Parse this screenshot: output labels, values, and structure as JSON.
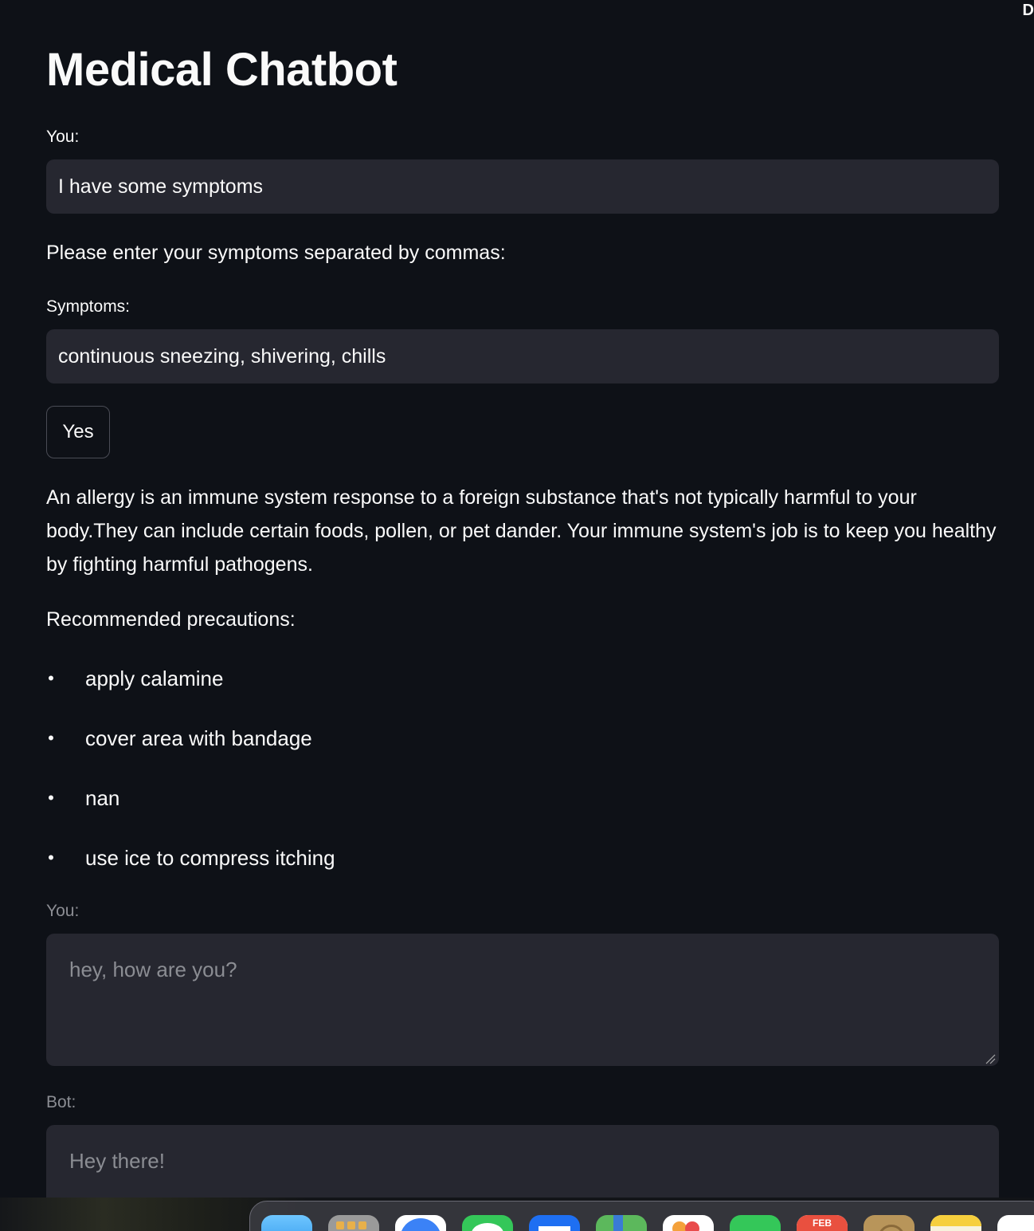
{
  "app": {
    "title": "Medical Chatbot",
    "corner_glyph": "D"
  },
  "first_input": {
    "label": "You:",
    "value": "I have some symptoms"
  },
  "prompt_text": "Please enter your symptoms separated by commas:",
  "symptoms_input": {
    "label": "Symptoms:",
    "value": "continuous sneezing, shivering, chills"
  },
  "yes_button_label": "Yes",
  "description": "An allergy is an immune system response to a foreign substance that's not typically harmful to your body.They can include certain foods, pollen, or pet dander. Your immune system's job is to keep you healthy by fighting harmful pathogens.",
  "precautions": {
    "heading": "Recommended precautions:",
    "bullet": "•",
    "items": [
      "apply calamine",
      "cover area with bandage",
      "nan",
      "use ice to compress itching"
    ]
  },
  "chat_input": {
    "label": "You:",
    "placeholder": "hey, how are you?"
  },
  "bot_output": {
    "label": "Bot:",
    "placeholder": "Hey there!"
  },
  "dock": {
    "calendar_month": "FEB",
    "icons": [
      "finder-icon",
      "launchpad-icon",
      "safari-icon",
      "messages-icon",
      "mail-icon",
      "maps-icon",
      "photos-icon",
      "facetime-icon",
      "calendar-icon",
      "contacts-icon",
      "notes-icon",
      "reminders-icon"
    ]
  }
}
